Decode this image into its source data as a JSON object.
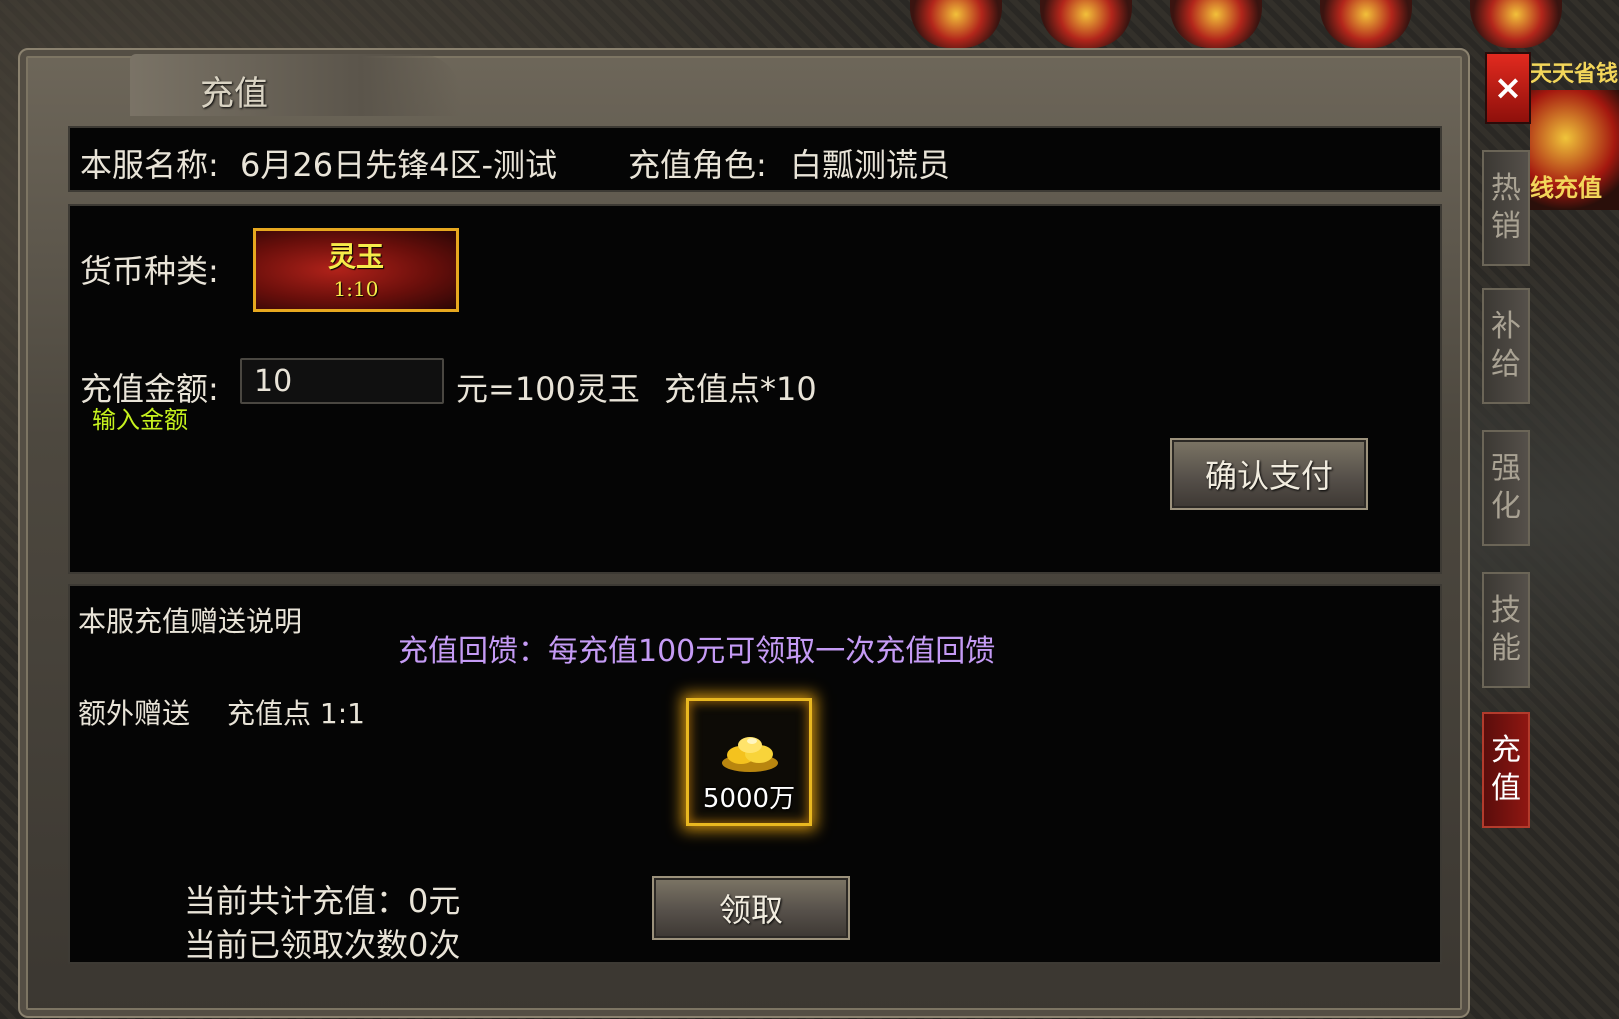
{
  "window": {
    "title": "充值",
    "close_icon": "×"
  },
  "info": {
    "server_label": "本服名称:",
    "server_value": "6月26日先锋4区-测试",
    "role_label": "充值角色:",
    "role_value": "白瓢测谎员"
  },
  "recharge": {
    "currency_label": "货币种类:",
    "currency_name": "灵玉",
    "currency_ratio": "1:10",
    "amount_label": "充值金额:",
    "amount_hint": "输入金额",
    "amount_value": "10",
    "amount_unit_text": "元=100灵玉",
    "points_text": "充值点*10",
    "confirm_button": "确认支付"
  },
  "gift": {
    "title": "本服充值赠送说明",
    "extra_label": "额外赠送",
    "extra_points": "充值点 1:1",
    "feedback_text": "充值回馈：每充值100元可领取一次充值回馈",
    "reward_label": "5000万",
    "claim_button": "领取",
    "total_recharge": "当前共计充值：0元",
    "claimed_count": "当前已领取次数0次"
  },
  "side_tabs": [
    {
      "label": "热销"
    },
    {
      "label": "补给"
    },
    {
      "label": "强化"
    },
    {
      "label": "技能"
    },
    {
      "label": "充值",
      "active": true
    }
  ],
  "right_banner": {
    "top": "天天省钱",
    "bottom": "线充值"
  },
  "colors": {
    "accent_gold": "#e9b820",
    "hint_green": "#c6f21e",
    "feedback_purple": "#c59bf5",
    "close_red": "#e22a1f"
  }
}
